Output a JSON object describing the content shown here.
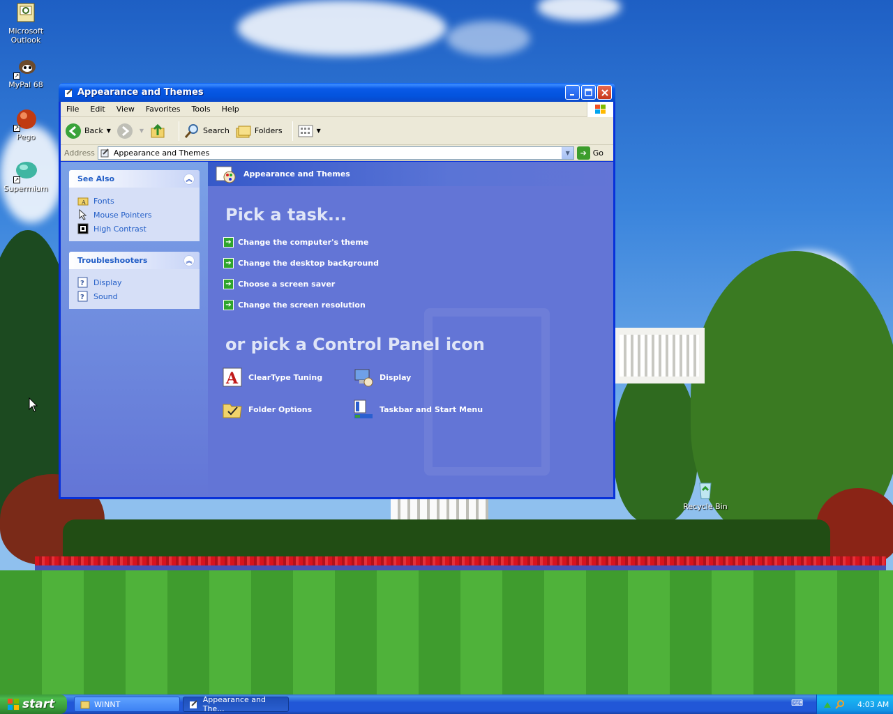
{
  "desktop": {
    "icons": [
      {
        "label": "Microsoft Outlook",
        "icon": "outlook-icon"
      },
      {
        "label": "MyPal 68",
        "icon": "mypal-icon"
      },
      {
        "label": "Pego",
        "icon": "pego-icon"
      },
      {
        "label": "Supermium",
        "icon": "supermium-icon"
      },
      {
        "label": "Recycle Bin",
        "icon": "recycle-bin-icon"
      }
    ]
  },
  "window": {
    "title": "Appearance and Themes",
    "menu": [
      "File",
      "Edit",
      "View",
      "Favorites",
      "Tools",
      "Help"
    ],
    "toolbar": {
      "back": "Back",
      "search": "Search",
      "folders": "Folders"
    },
    "address": {
      "label": "Address",
      "value": "Appearance and Themes",
      "go": "Go"
    },
    "see_also": {
      "title": "See Also",
      "links": [
        "Fonts",
        "Mouse Pointers",
        "High Contrast"
      ]
    },
    "troubleshooters": {
      "title": "Troubleshooters",
      "links": [
        "Display",
        "Sound"
      ]
    },
    "header": "Appearance and Themes",
    "pick_task": "Pick a task...",
    "tasks": [
      "Change the computer's theme",
      "Change the desktop background",
      "Choose a screen saver",
      "Change the screen resolution"
    ],
    "pick_icon": "or pick a Control Panel icon",
    "cp_icons": [
      "ClearType Tuning",
      "Display",
      "Folder Options",
      "Taskbar and Start Menu"
    ]
  },
  "taskbar": {
    "start": "start",
    "buttons": [
      "WINNT",
      "Appearance and The..."
    ],
    "clock": "4:03 AM"
  },
  "colors": {
    "title_blue": "#0a5ae8",
    "pane_blue": "#6375d6",
    "link_blue": "#215dc6",
    "start_green": "#3a9b3a"
  }
}
